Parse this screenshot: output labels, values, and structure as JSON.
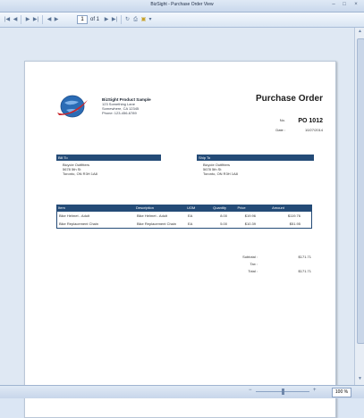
{
  "window": {
    "title": "BizSight - Purchase Order View"
  },
  "window_controls": {
    "minimize": "–",
    "maximize": "□",
    "close": "×"
  },
  "toolbar": {
    "first": "|◀",
    "prev": "◀",
    "next": "▶",
    "last": "▶|",
    "page_value": "1",
    "page_of": "of 1",
    "refresh": "↻",
    "print": "⎙",
    "save": "▣",
    "export": "▾"
  },
  "company": {
    "name": "BizSight Product Sample",
    "address1": "123 Something Lane",
    "address2": "Somewhere, CA 12345",
    "phone": "Phone: 123-456-6789"
  },
  "document": {
    "title": "Purchase Order",
    "no_label": "No.",
    "no_value": "PO 1012",
    "date_label": "Date :",
    "date_value": "10/27/2014"
  },
  "bill_to": {
    "heading": "Bill To",
    "line1": "Bicycle Outfitters",
    "line2": "5678 5th St",
    "line3": "Toronto, ON  R3H 1A8"
  },
  "ship_to": {
    "heading": "Ship To",
    "line1": "Bicycle Outfitters",
    "line2": "5678 5th St",
    "line3": "Toronto, ON  R3H 1A8"
  },
  "items": {
    "headers": {
      "item": "Item",
      "description": "Description",
      "uom": "UOM",
      "quantity": "Quantity",
      "price": "Price",
      "amount": "Amount"
    },
    "rows": [
      {
        "item": "Bike Helmet - Adult",
        "description": "Bike Helmet - Adult",
        "uom": "EA",
        "quantity": "8.00",
        "price": "$19.96",
        "amount": "$119.76"
      },
      {
        "item": "Bike Replacement Chain",
        "description": "Bike Replacement Chain",
        "uom": "EA",
        "quantity": "5.00",
        "price": "$10.39",
        "amount": "$51.95"
      }
    ]
  },
  "totals": {
    "subtotal_label": "Subtotal :",
    "subtotal_value": "$171.71",
    "tax_label": "Tax :",
    "tax_value": "",
    "total_label": "Total :",
    "total_value": "$171.71"
  },
  "status": {
    "zoom": "100 %",
    "zoom_minus": "−",
    "zoom_plus": "+"
  },
  "scroll": {
    "up": "▲",
    "down": "▼"
  }
}
